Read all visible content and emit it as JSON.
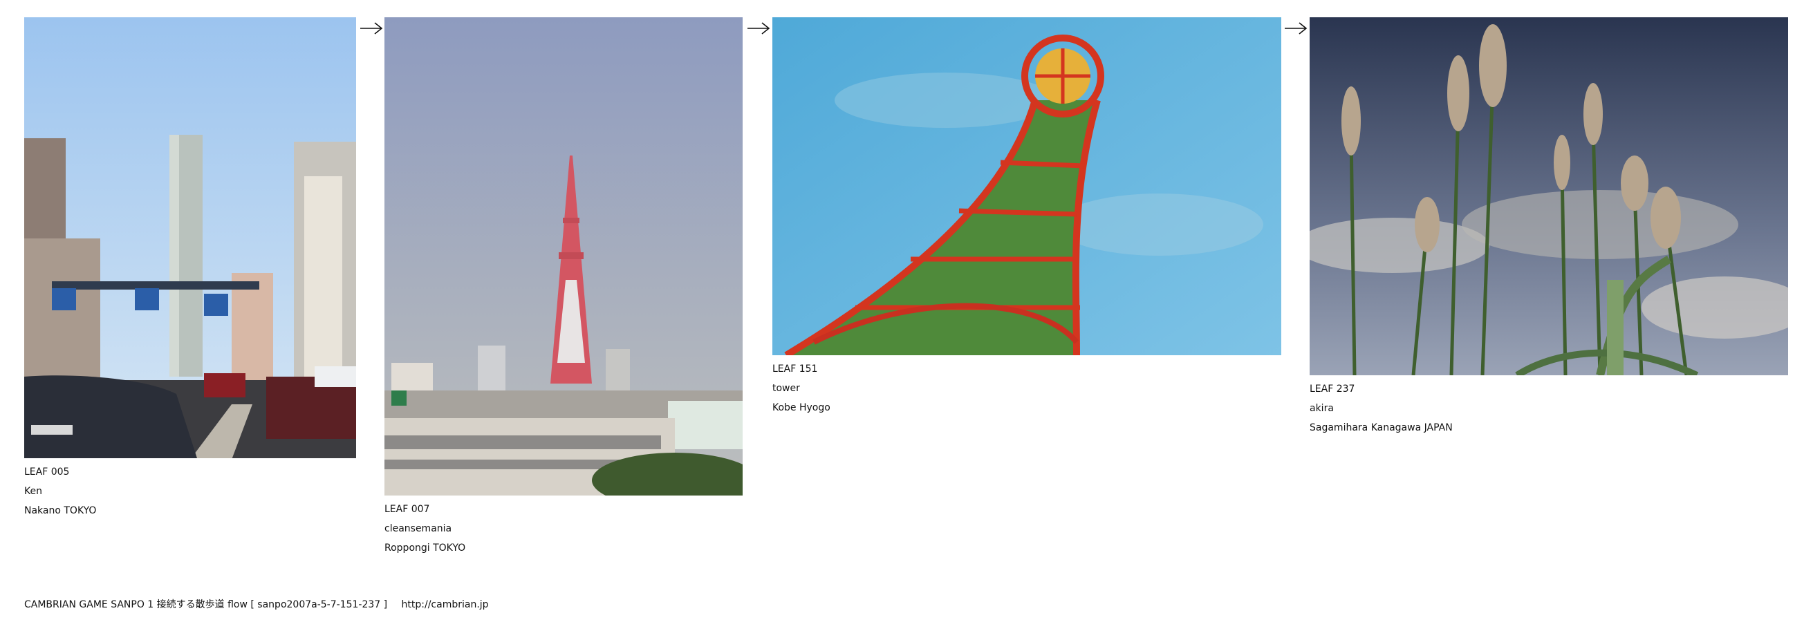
{
  "leaves": [
    {
      "id": "LEAF 005",
      "author": "Ken",
      "location": "Nakano TOKYO"
    },
    {
      "id": "LEAF 007",
      "author": "cleansemania",
      "location": "Roppongi TOKYO"
    },
    {
      "id": "LEAF 151",
      "author": "tower",
      "location": "Kobe Hyogo"
    },
    {
      "id": "LEAF 237",
      "author": "akira",
      "location": "Sagamihara Kanagawa JAPAN"
    }
  ],
  "arrow_glyph": "→",
  "footer": {
    "text": "CAMBRIAN GAME  SANPO 1 接続する散歩道 flow [ sanpo2007a-5-7-151-237 ]",
    "link": "http://cambrian.jp"
  }
}
